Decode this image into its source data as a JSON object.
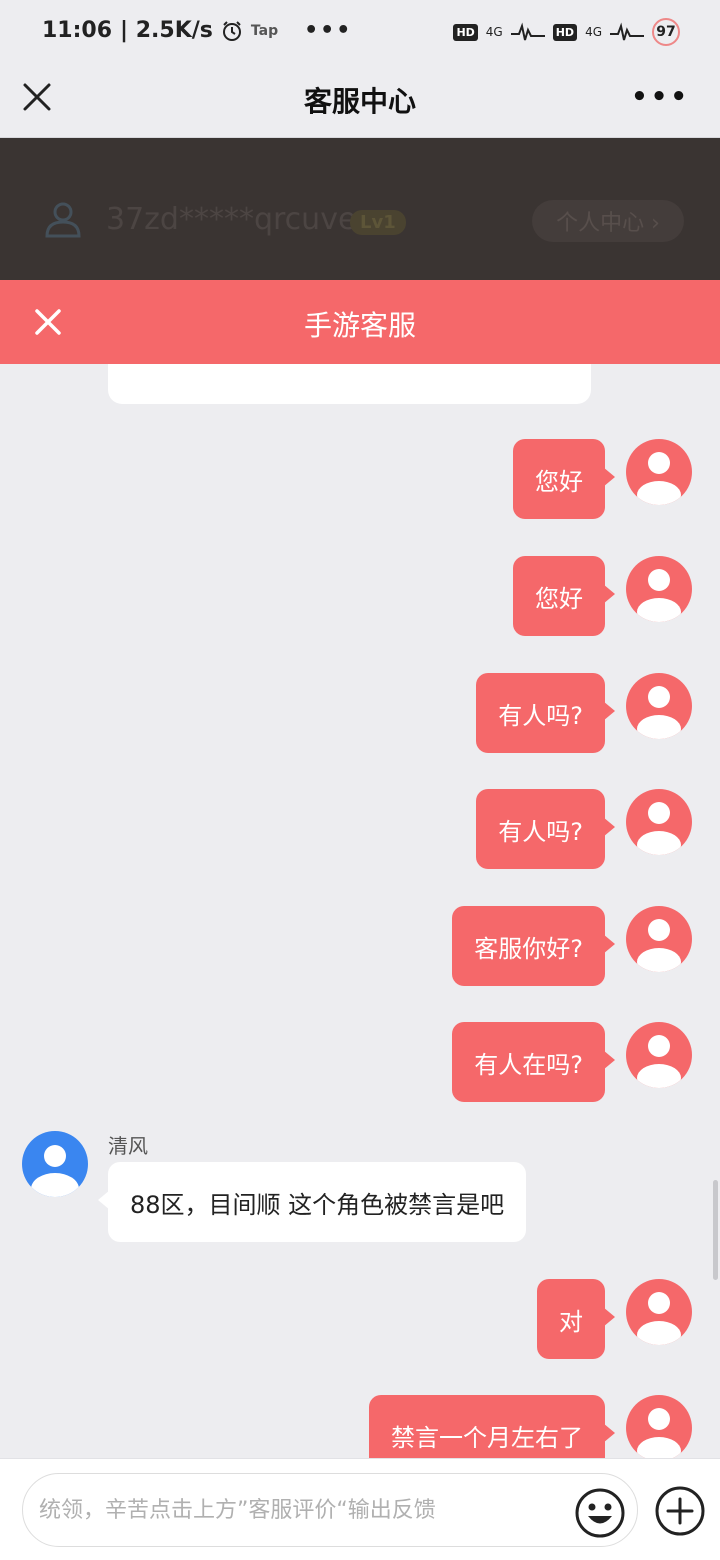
{
  "status_bar": {
    "time": "11:06",
    "speed": "| 2.5K/s",
    "tap_label": "Tap",
    "net1": "4G",
    "net2": "4G",
    "battery": "97"
  },
  "title_bar": {
    "title": "客服中心"
  },
  "dimmed_page": {
    "username": "37zd*****qrcuve",
    "level": "Lv1",
    "personal_center": "个人中心 ›"
  },
  "chat_header": {
    "title": "手游客服"
  },
  "messages": [
    {
      "side": "right",
      "text": "您好"
    },
    {
      "side": "right",
      "text": "您好"
    },
    {
      "side": "right",
      "text": "有人吗?"
    },
    {
      "side": "right",
      "text": "有人吗?"
    },
    {
      "side": "right",
      "text": "客服你好?"
    },
    {
      "side": "right",
      "text": "有人在吗?"
    },
    {
      "side": "left",
      "sender": "清风",
      "text": "88区，目间顺  这个角色被禁言是吧"
    },
    {
      "side": "right",
      "text": "对"
    },
    {
      "side": "right",
      "text": "禁言一个月左右了"
    }
  ],
  "input": {
    "placeholder": "统领，辛苦点击上方”客服评价“输出反馈"
  },
  "colors": {
    "accent": "#f5686a",
    "background": "#ededf0",
    "agent_avatar": "#3a86f0"
  }
}
